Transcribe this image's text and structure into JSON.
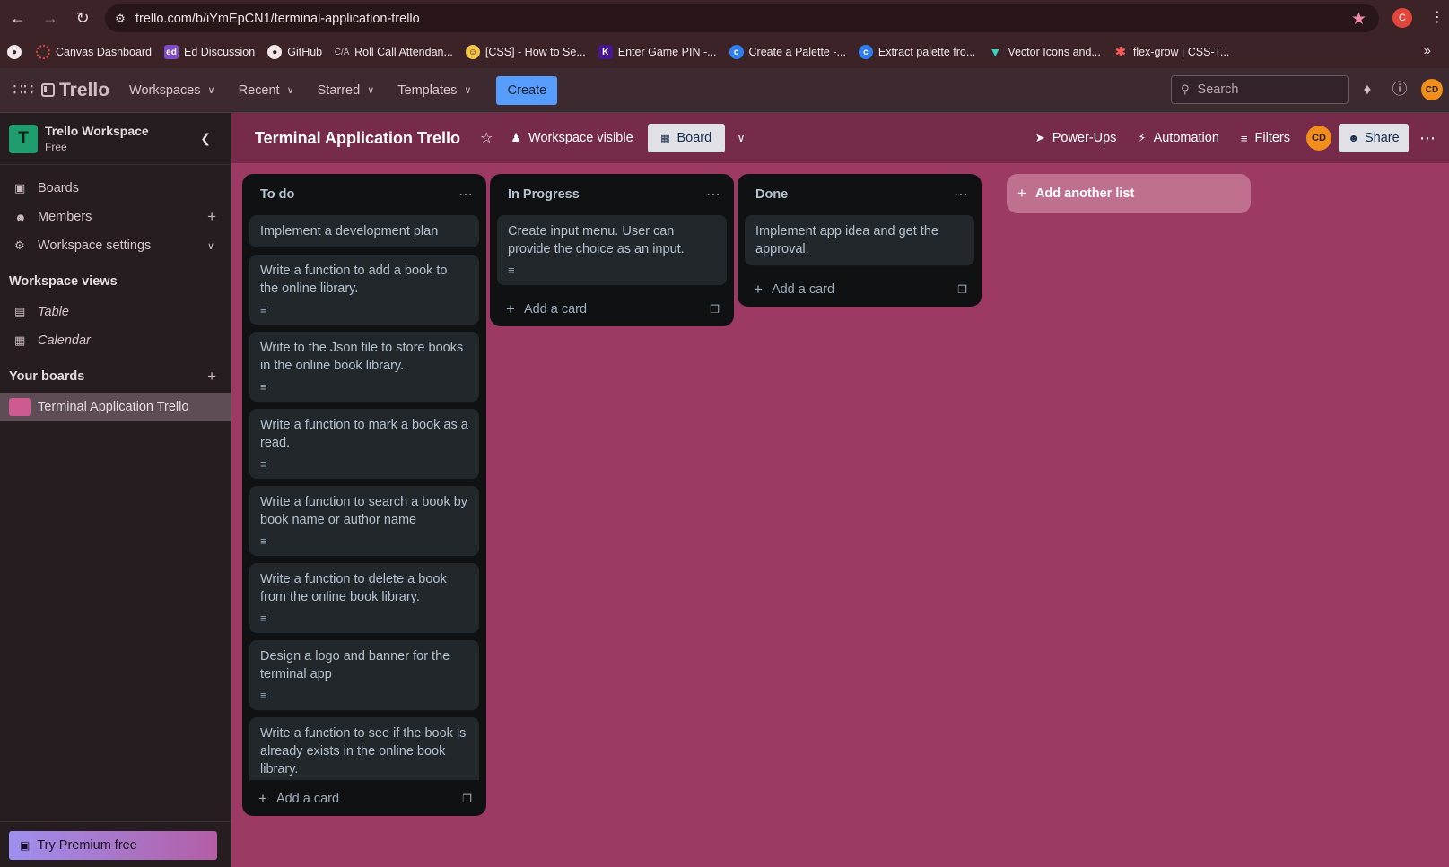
{
  "browser": {
    "url": "trello.com/b/iYmEpCN1/terminal-application-trello",
    "profile_initial": "C",
    "bookmarks": [
      {
        "label": "",
        "icon": "github-icon"
      },
      {
        "label": "Canvas Dashboard",
        "icon": "canvas-icon"
      },
      {
        "label": "Ed Discussion",
        "icon": "ed-icon"
      },
      {
        "label": "GitHub",
        "icon": "github-icon"
      },
      {
        "label": "Roll Call Attendan...",
        "icon": "rollcall-icon"
      },
      {
        "label": "[CSS] - How to Se...",
        "icon": "css-icon"
      },
      {
        "label": "Enter Game PIN -...",
        "icon": "kahoot-icon"
      },
      {
        "label": "Create a Palette -...",
        "icon": "palette-icon"
      },
      {
        "label": "Extract palette fro...",
        "icon": "palette-icon"
      },
      {
        "label": "Vector Icons and...",
        "icon": "vector-icon"
      },
      {
        "label": "flex-grow | CSS-T...",
        "icon": "csstricks-icon"
      }
    ]
  },
  "header": {
    "logo": "Trello",
    "menus": [
      "Workspaces",
      "Recent",
      "Starred",
      "Templates"
    ],
    "create": "Create",
    "search_placeholder": "Search",
    "avatar": "CD"
  },
  "sidebar": {
    "workspace_initial": "T",
    "workspace_name": "Trello Workspace",
    "workspace_plan": "Free",
    "items": [
      "Boards",
      "Members",
      "Workspace settings"
    ],
    "views_heading": "Workspace views",
    "views": [
      "Table",
      "Calendar"
    ],
    "boards_heading": "Your boards",
    "boards": [
      "Terminal Application Trello"
    ],
    "premium": "Try Premium free"
  },
  "board": {
    "title": "Terminal Application Trello",
    "visibility": "Workspace visible",
    "view": "Board",
    "power_ups": "Power-Ups",
    "automation": "Automation",
    "filters": "Filters",
    "member": "CD",
    "share": "Share",
    "add_list": "Add another list",
    "add_card": "Add a card",
    "lists": [
      {
        "name": "To do",
        "cards": [
          {
            "text": "Implement a development plan",
            "has_description": false
          },
          {
            "text": "Write a function to add a book to the online library.",
            "has_description": true
          },
          {
            "text": "Write to the Json file to store books in the online book library.",
            "has_description": true
          },
          {
            "text": "Write a function to mark a book as a read.",
            "has_description": true
          },
          {
            "text": "Write a function to search a book by book name or author name",
            "has_description": true
          },
          {
            "text": "Write a function to delete a book from the online book library.",
            "has_description": true
          },
          {
            "text": "Design a logo and banner for the terminal app",
            "has_description": true
          },
          {
            "text": "Write a function to see if the book is already exists in the online book library.",
            "has_description": false
          }
        ]
      },
      {
        "name": "In Progress",
        "cards": [
          {
            "text": "Create input menu. User can provide the choice as an input.",
            "has_description": true
          }
        ]
      },
      {
        "name": "Done",
        "cards": [
          {
            "text": "Implement app idea and get the approval.",
            "has_description": false
          }
        ]
      }
    ]
  },
  "colors": {
    "board_bg": "#9c3a64",
    "board_header": "#772b4a",
    "list_bg": "#0f1112",
    "card_bg": "#22272b",
    "accent": "#579dff"
  }
}
